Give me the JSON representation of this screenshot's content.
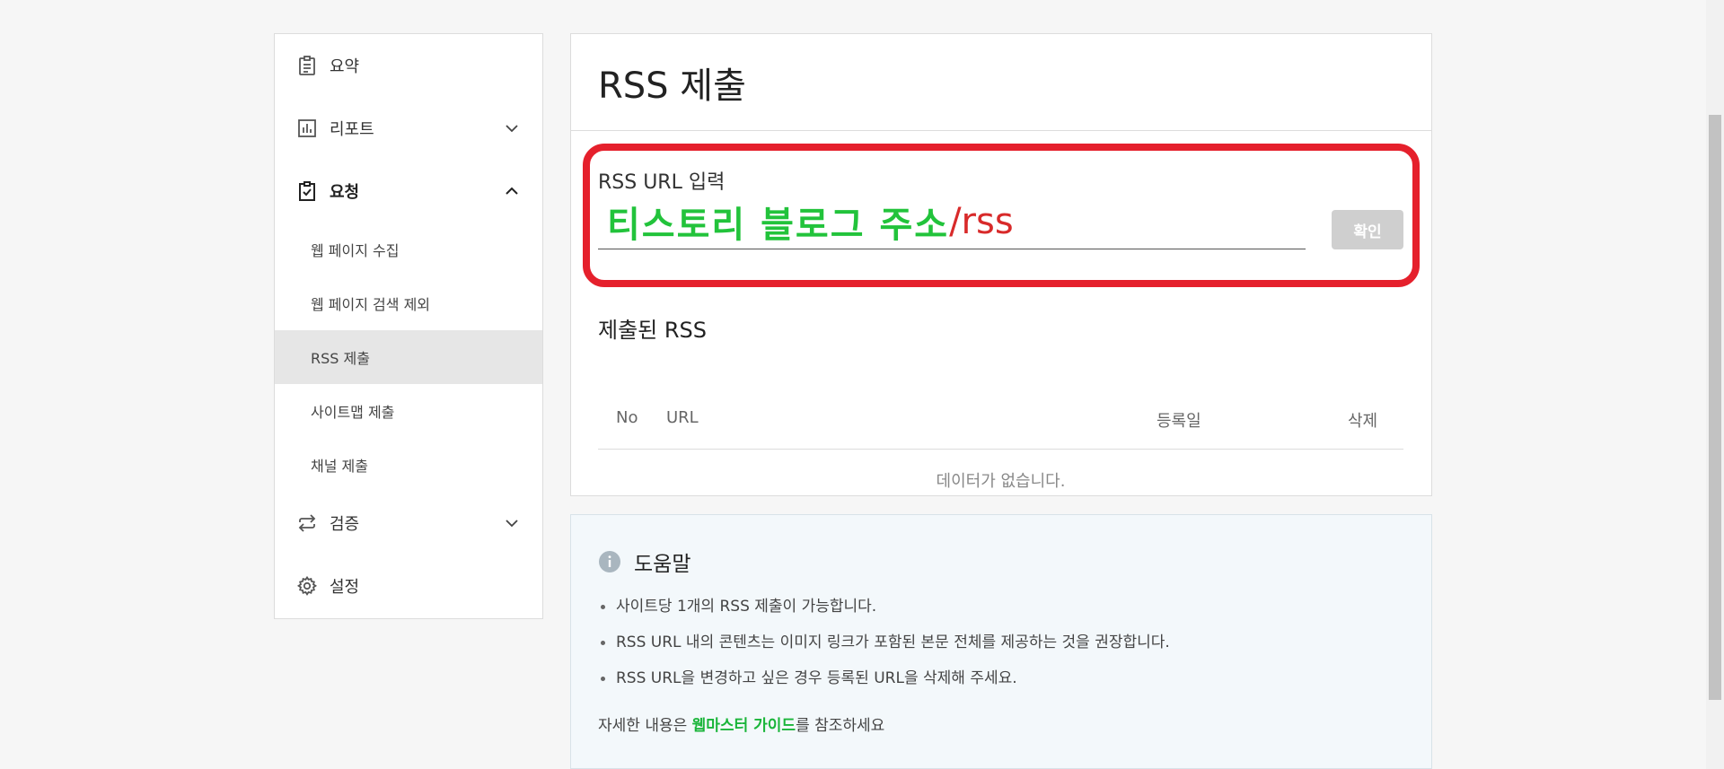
{
  "sidebar": {
    "summary": "요약",
    "report": "리포트",
    "request": "요청",
    "sub_items": [
      "웹 페이지 수집",
      "웹 페이지 검색 제외",
      "RSS 제출",
      "사이트맵 제출",
      "채널 제출"
    ],
    "verify": "검증",
    "settings": "설정"
  },
  "main": {
    "title": "RSS 제출",
    "input_label": "RSS URL 입력",
    "input_value_green": "티스토리 블로그 주소",
    "input_value_red": "/rss",
    "confirm_label": "확인",
    "submitted_title": "제출된 RSS",
    "columns": [
      "No",
      "URL",
      "등록일",
      "삭제"
    ],
    "empty_text": "데이터가 없습니다."
  },
  "help": {
    "title": "도움말",
    "items": [
      "사이트당 1개의 RSS 제출이 가능합니다.",
      "RSS URL 내의 콘텐츠는 이미지 링크가 포함된 본문 전체를 제공하는 것을 권장합니다.",
      "RSS URL을 변경하고 싶은 경우 등록된 URL을 삭제해 주세요."
    ],
    "footer_prefix": "자세한 내용은 ",
    "footer_link": "웹마스터 가이드",
    "footer_suffix": "를 참조하세요"
  },
  "colors": {
    "highlight": "#e5202c",
    "link_green": "#1ab53a",
    "input_green": "#22c33b",
    "input_red": "#d82a2a"
  }
}
